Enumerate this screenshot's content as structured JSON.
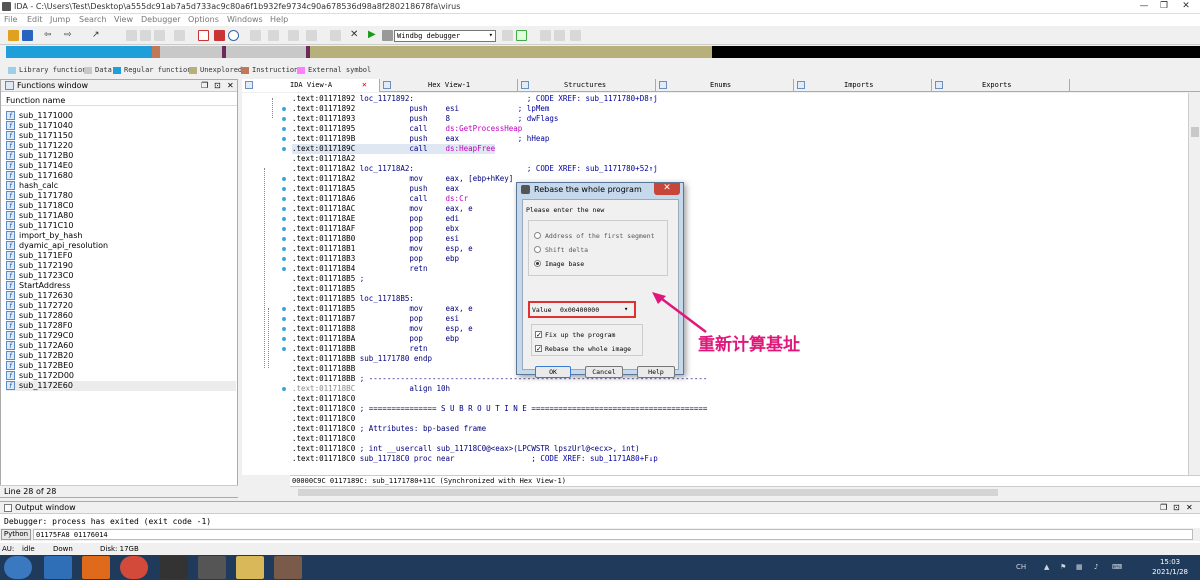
{
  "window": {
    "title": "IDA - C:\\Users\\Test\\Desktop\\a555dc91ab7a5d733ac9c80a6f1b932fe9734c90a678536d98a8f280218678fa\\virus",
    "controls": [
      "—",
      "❐",
      "✕"
    ]
  },
  "menu": [
    "File",
    "Edit",
    "Jump",
    "Search",
    "View",
    "Debugger",
    "Options",
    "Windows",
    "Help"
  ],
  "toolbar": {
    "debugger_select": "Windbg debugger"
  },
  "legend": [
    {
      "label": "Library function",
      "color": "#9ccfe8"
    },
    {
      "label": "Data",
      "color": "#c8c8c8"
    },
    {
      "label": "Regular function",
      "color": "#1f9fd9"
    },
    {
      "label": "Unexplored",
      "color": "#b7b07b"
    },
    {
      "label": "Instruction",
      "color": "#c07858"
    },
    {
      "label": "External symbol",
      "color": "#ff80ff"
    }
  ],
  "functions_window": {
    "title": "Functions window",
    "column": "Function name",
    "items": [
      "sub_1171000",
      "sub_1171040",
      "sub_1171150",
      "sub_1171220",
      "sub_11712B0",
      "sub_11714E0",
      "sub_1171680",
      "hash_calc",
      "sub_1171780",
      "sub_11718C0",
      "sub_1171A80",
      "sub_1171C10",
      "import_by_hash",
      "dyamic_api_resolution",
      "sub_1171EF0",
      "sub_1172190",
      "sub_11723C0",
      "StartAddress",
      "sub_1172630",
      "sub_1172720",
      "sub_1172860",
      "sub_11728F0",
      "sub_11729C0",
      "sub_1172A60",
      "sub_1172B20",
      "sub_1172BE0",
      "sub_1172D00",
      "sub_1172E60"
    ],
    "selected_index": 27,
    "line_info": "Line 28 of 28"
  },
  "tabs": [
    "IDA View-A",
    "Hex View-1",
    "Structures",
    "Enums",
    "Imports",
    "Exports"
  ],
  "code_lines": [
    {
      "addr": ".text:01171892",
      "label": "loc_1171892:",
      "mn": "",
      "op": "",
      "cm": "; CODE XREF: sub_1171780+D8↑j"
    },
    {
      "addr": ".text:01171892",
      "label": "",
      "mn": "push",
      "op": "esi",
      "cm": "; lpMem"
    },
    {
      "addr": ".text:01171893",
      "label": "",
      "mn": "push",
      "op": "8",
      "cm": "; dwFlags"
    },
    {
      "addr": ".text:01171895",
      "label": "",
      "mn": "call",
      "op": "ds:GetProcessHeap",
      "cm": ""
    },
    {
      "addr": ".text:0117189B",
      "label": "",
      "mn": "push",
      "op": "eax",
      "cm": "; hHeap"
    },
    {
      "addr": ".text:0117189C",
      "label": "",
      "mn": "call",
      "op": "ds:HeapFree",
      "cm": ""
    },
    {
      "addr": ".text:011718A2",
      "label": "",
      "mn": "",
      "op": "",
      "cm": ""
    },
    {
      "addr": ".text:011718A2",
      "label": "loc_11718A2:",
      "mn": "",
      "op": "",
      "cm": "; CODE XREF: sub_1171780+52↑j"
    },
    {
      "addr": ".text:011718A2",
      "label": "",
      "mn": "mov",
      "op": "eax, [ebp+hKey]",
      "cm": ""
    },
    {
      "addr": ".text:011718A5",
      "label": "",
      "mn": "push",
      "op": "eax",
      "cm": ""
    },
    {
      "addr": ".text:011718A6",
      "label": "",
      "mn": "call",
      "op": "ds:Cr",
      "cm": ""
    },
    {
      "addr": ".text:011718AC",
      "label": "",
      "mn": "mov",
      "op": "eax, e",
      "cm": ""
    },
    {
      "addr": ".text:011718AE",
      "label": "",
      "mn": "pop",
      "op": "edi",
      "cm": ""
    },
    {
      "addr": ".text:011718AF",
      "label": "",
      "mn": "pop",
      "op": "ebx",
      "cm": ""
    },
    {
      "addr": ".text:011718B0",
      "label": "",
      "mn": "pop",
      "op": "esi",
      "cm": ""
    },
    {
      "addr": ".text:011718B1",
      "label": "",
      "mn": "mov",
      "op": "esp, e",
      "cm": ""
    },
    {
      "addr": ".text:011718B3",
      "label": "",
      "mn": "pop",
      "op": "ebp",
      "cm": ""
    },
    {
      "addr": ".text:011718B4",
      "label": "",
      "mn": "retn",
      "op": "",
      "cm": ""
    },
    {
      "addr": ".text:011718B5",
      "label": ";",
      "mn": "",
      "op": "",
      "cm": ""
    },
    {
      "addr": ".text:011718B5",
      "label": "",
      "mn": "",
      "op": "",
      "cm": ""
    },
    {
      "addr": ".text:011718B5",
      "label": "loc_11718B5:",
      "mn": "",
      "op": "",
      "cm": "+20↑j"
    },
    {
      "addr": ".text:011718B5",
      "label": "",
      "mn": "mov",
      "op": "eax, e",
      "cm": ""
    },
    {
      "addr": ".text:011718B7",
      "label": "",
      "mn": "pop",
      "op": "esi",
      "cm": ""
    },
    {
      "addr": ".text:011718B8",
      "label": "",
      "mn": "mov",
      "op": "esp, e",
      "cm": ""
    },
    {
      "addr": ".text:011718BA",
      "label": "",
      "mn": "pop",
      "op": "ebp",
      "cm": ""
    },
    {
      "addr": ".text:011718BB",
      "label": "",
      "mn": "retn",
      "op": "",
      "cm": ""
    },
    {
      "addr": ".text:011718BB",
      "label": "sub_1171780",
      "mn": "endp",
      "op": "",
      "cm": ""
    },
    {
      "addr": ".text:011718BB",
      "label": "",
      "mn": "",
      "op": "",
      "cm": ""
    },
    {
      "addr": ".text:011718BB",
      "label": "; ---------------------------------------------------------------------------",
      "mn": "",
      "op": "",
      "cm": ""
    },
    {
      "addr": ".text:011718BC",
      "label": "",
      "mn": "align 10h",
      "op": "",
      "cm": "",
      "grey": true
    },
    {
      "addr": ".text:011718C0",
      "label": "",
      "mn": "",
      "op": "",
      "cm": ""
    },
    {
      "addr": ".text:011718C0",
      "label": "; =============== S U B R O U T I N E =======================================",
      "mn": "",
      "op": "",
      "cm": ""
    },
    {
      "addr": ".text:011718C0",
      "label": "",
      "mn": "",
      "op": "",
      "cm": ""
    },
    {
      "addr": ".text:011718C0",
      "label": "; Attributes: bp-based frame",
      "mn": "",
      "op": "",
      "cm": ""
    },
    {
      "addr": ".text:011718C0",
      "label": "",
      "mn": "",
      "op": "",
      "cm": ""
    },
    {
      "addr": ".text:011718C0",
      "label": "; int __usercall sub_11718C0@<eax>(LPCWSTR lpszUrl@<ecx>, int)",
      "mn": "",
      "op": "",
      "cm": ""
    },
    {
      "addr": ".text:011718C0",
      "label": "sub_11718C0",
      "mn": "proc near",
      "op": "",
      "cm": "; CODE XREF: sub_1171A80+F↓p"
    }
  ],
  "sync_status": "00000C9C 0117189C: sub_1171780+11C (Synchronized with Hex View-1)",
  "output": {
    "title": "Output window",
    "message": "Debugger: process has exited (exit code -1)"
  },
  "python": {
    "button": "Python",
    "value": "01175FA8 01176014"
  },
  "statusbar": {
    "au": "AU:",
    "state": "idle",
    "direction": "Down",
    "disk": "Disk: 17GB"
  },
  "dialog": {
    "title": "Rebase the whole program",
    "prompt": "Please enter the new",
    "options": [
      "Address of the first segment",
      "Shift delta",
      "Image base"
    ],
    "selected_option": 2,
    "value_label": "Value",
    "value": "0x00400000",
    "checkboxes": [
      {
        "label": "Fix up the program",
        "checked": true
      },
      {
        "label": "Rebase the whole image",
        "checked": true
      }
    ],
    "buttons": [
      "OK",
      "Cancel",
      "Help"
    ]
  },
  "annotation": "重新计算基址",
  "taskbar": {
    "time": "15:03",
    "date": "2021/1/28",
    "tray_lang": "CH"
  }
}
